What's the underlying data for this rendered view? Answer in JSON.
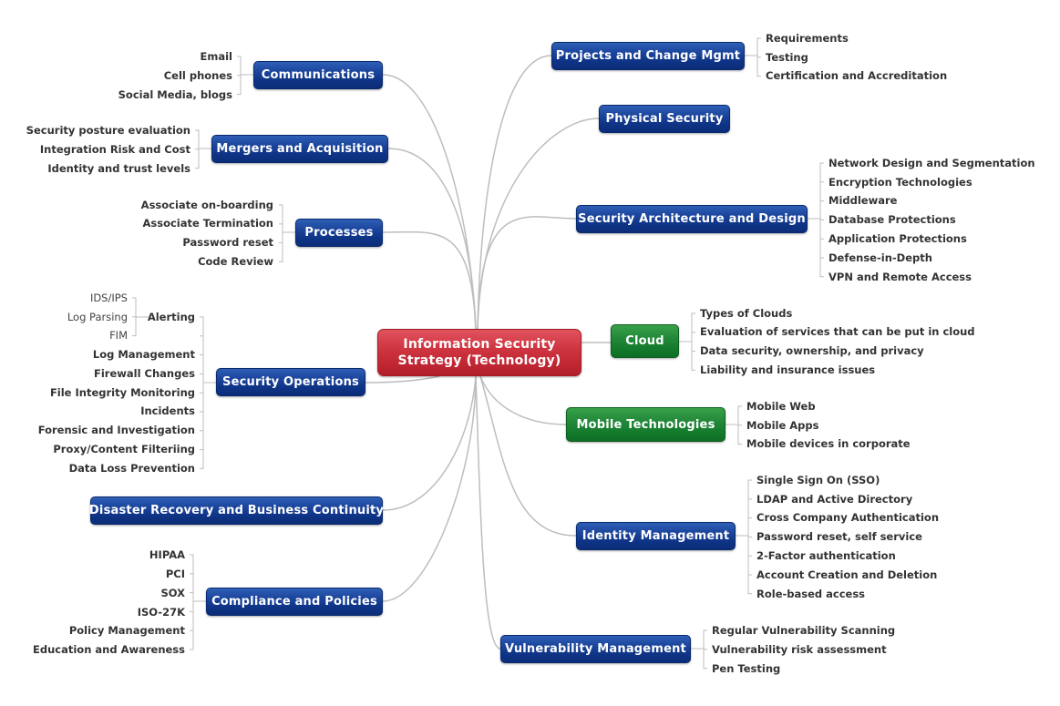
{
  "central": {
    "line1": "Information Security",
    "line2": "Strategy (Technology)",
    "color": "#c8303b"
  },
  "colors": {
    "blue_node": "#11388a",
    "green_node": "#1a8032",
    "connector": "#bdbdbd",
    "leaf_text": "#333333"
  },
  "left_topics": [
    {
      "id": "communications",
      "label": "Communications",
      "children": [
        "Email",
        "Cell phones",
        "Social Media, blogs"
      ]
    },
    {
      "id": "mergers",
      "label": "Mergers and Acquisition",
      "children": [
        "Security posture evaluation",
        "Integration Risk and Cost",
        "Identity and trust levels"
      ]
    },
    {
      "id": "processes",
      "label": "Processes",
      "children": [
        "Associate on-boarding",
        "Associate Termination",
        "Password reset",
        "Code Review"
      ]
    },
    {
      "id": "secops",
      "label": "Security Operations",
      "alerting": {
        "label": "Alerting",
        "children": [
          "IDS/IPS",
          "Log Parsing",
          "FIM"
        ]
      },
      "children": [
        "Log Management",
        "Firewall Changes",
        "File Integrity Monitoring",
        "Incidents",
        "Forensic and Investigation",
        "Proxy/Content Filteriing",
        "Data Loss Prevention"
      ]
    },
    {
      "id": "drbc",
      "label": "Disaster Recovery and Business Continuity",
      "children": []
    },
    {
      "id": "compliance",
      "label": "Compliance and Policies",
      "children": [
        "HIPAA",
        "PCI",
        "SOX",
        "ISO-27K",
        "Policy Management",
        "Education and Awareness"
      ]
    }
  ],
  "right_topics": [
    {
      "id": "projects",
      "label": "Projects and Change Mgmt",
      "children": [
        "Requirements",
        "Testing",
        "Certification and Accreditation"
      ]
    },
    {
      "id": "physical",
      "label": "Physical Security",
      "children": []
    },
    {
      "id": "architecture",
      "label": "Security Architecture and Design",
      "children": [
        "Network Design and Segmentation",
        "Encryption Technologies",
        "Middleware",
        "Database Protections",
        "Application Protections",
        "Defense-in-Depth",
        "VPN and Remote Access"
      ]
    },
    {
      "id": "cloud",
      "label": "Cloud",
      "children": [
        "Types of Clouds",
        "Evaluation of services that can be put in cloud",
        "Data security, ownership, and privacy",
        "Liability and insurance issues"
      ]
    },
    {
      "id": "mobile",
      "label": "Mobile Technologies",
      "children": [
        "Mobile Web",
        "Mobile Apps",
        "Mobile devices in corporate"
      ]
    },
    {
      "id": "identity",
      "label": "Identity Management",
      "children": [
        "Single Sign On (SSO)",
        "LDAP and Active Directory",
        "Cross Company Authentication",
        "Password reset, self service",
        "2-Factor authentication",
        "Account Creation and Deletion",
        "Role-based access"
      ]
    },
    {
      "id": "vuln",
      "label": "Vulnerability Management",
      "children": [
        "Regular Vulnerability Scanning",
        "Vulnerability risk assessment",
        "Pen Testing"
      ]
    }
  ]
}
